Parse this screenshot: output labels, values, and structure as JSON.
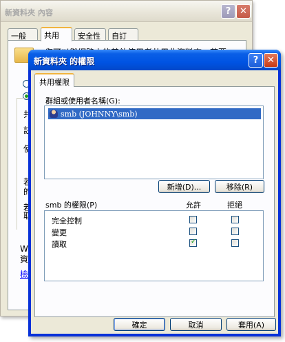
{
  "back_window": {
    "title": "新資料夾 內容",
    "tabs": [
      "一般",
      "共用",
      "安全性",
      "自訂"
    ],
    "fragments": {
      "line1": "您可以與網路上的其他使用者共用此資料夾。若要",
      "gong": "共",
      "zhu": "註",
      "shi": "使",
      "ruo1": "若",
      "de": "的",
      "ruo2": "若",
      "qu": "取",
      "wi": "Wi",
      "zi": "資料",
      "jian": "檢"
    }
  },
  "dialog": {
    "title": "新資料夾 的權限",
    "tab": "共用權限",
    "users_label": "群組或使用者名稱(G):",
    "users": [
      {
        "name": "smb (JOHNNY\\smb)"
      }
    ],
    "add_button": "新增(D)...",
    "remove_button": "移除(R)",
    "perm_label": "smb 的權限(P)",
    "allow_header": "允許",
    "deny_header": "拒絕",
    "permissions": [
      {
        "name": "完全控制",
        "allow": false,
        "deny": false
      },
      {
        "name": "變更",
        "allow": false,
        "deny": false
      },
      {
        "name": "讀取",
        "allow": true,
        "deny": false
      }
    ],
    "ok_button": "確定",
    "cancel_button": "取消",
    "apply_button": "套用(A)"
  }
}
